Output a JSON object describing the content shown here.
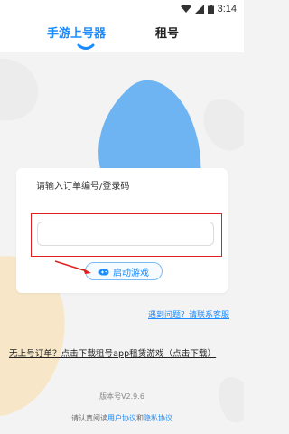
{
  "status_bar": {
    "time": "3:14"
  },
  "nav": {
    "tabs": [
      {
        "label": "手游上号器",
        "active": true
      },
      {
        "label": "租号",
        "active": false
      }
    ]
  },
  "card": {
    "title": "请输入订单编号/登录码",
    "input_value": "",
    "input_placeholder": "",
    "launch_label": "启动游戏"
  },
  "help_link": "遇到问题？请联系客服",
  "promo_link": "无上号订单？点击下载租号app租赁游戏（点击下载）",
  "version": "版本号V2.9.6",
  "agreement": {
    "prefix": "请认真阅读",
    "user_agreement": "用户协议",
    "and": "和",
    "privacy": "隐私协议"
  },
  "colors": {
    "accent": "#1a8cff",
    "highlight_border": "#e02020",
    "background": "#f3f3f3"
  }
}
